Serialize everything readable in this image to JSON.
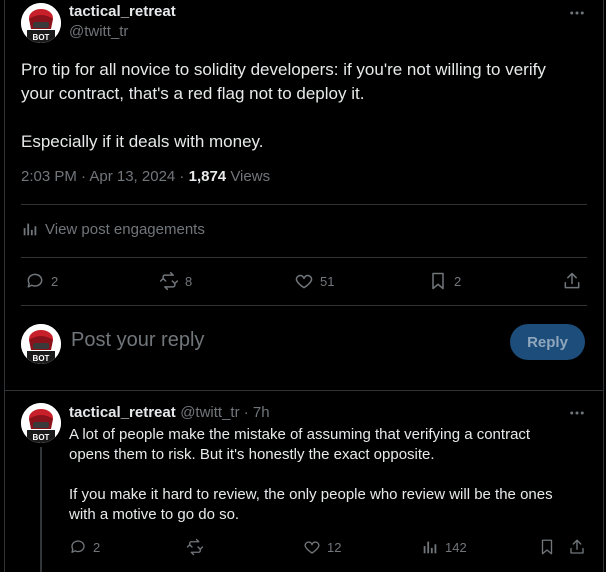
{
  "main_post": {
    "author_name": "tactical_retreat",
    "author_handle": "@twitt_tr",
    "avatar_badge": "BOT",
    "text_line1": "Pro tip for all novice to solidity developers: if you're not willing to verify",
    "text_line2": "your contract, that's a red flag not to deploy it.",
    "text_line3": "Especially if it deals with money.",
    "timestamp": "2:03 PM · Apr 13, 2024 ·",
    "views_count": "1,874",
    "views_label": "Views",
    "engagements_label": "View post engagements",
    "stats": {
      "replies": "2",
      "reposts": "8",
      "likes": "51",
      "bookmarks": "2"
    }
  },
  "reply_composer": {
    "avatar_badge": "BOT",
    "placeholder": "Post your reply",
    "button_label": "Reply"
  },
  "reply_post": {
    "author_name": "tactical_retreat",
    "handle_time": "@twitt_tr · 7h",
    "avatar_badge": "BOT",
    "para1_line1": "A lot of people make the mistake of assuming that verifying a contract",
    "para1_line2": "opens them to risk. But it's honestly the exact opposite.",
    "para2_line1": "If you make it hard to review, the only people who review will be the ones",
    "para2_line2": "with a motive to go do so.",
    "stats": {
      "replies": "2",
      "likes": "12",
      "views": "142"
    }
  },
  "colors": {
    "background": "#000000",
    "text": "#e7e9ea",
    "muted": "#71767b",
    "divider": "#2f3336",
    "reply_button": "#1d4d7a"
  }
}
